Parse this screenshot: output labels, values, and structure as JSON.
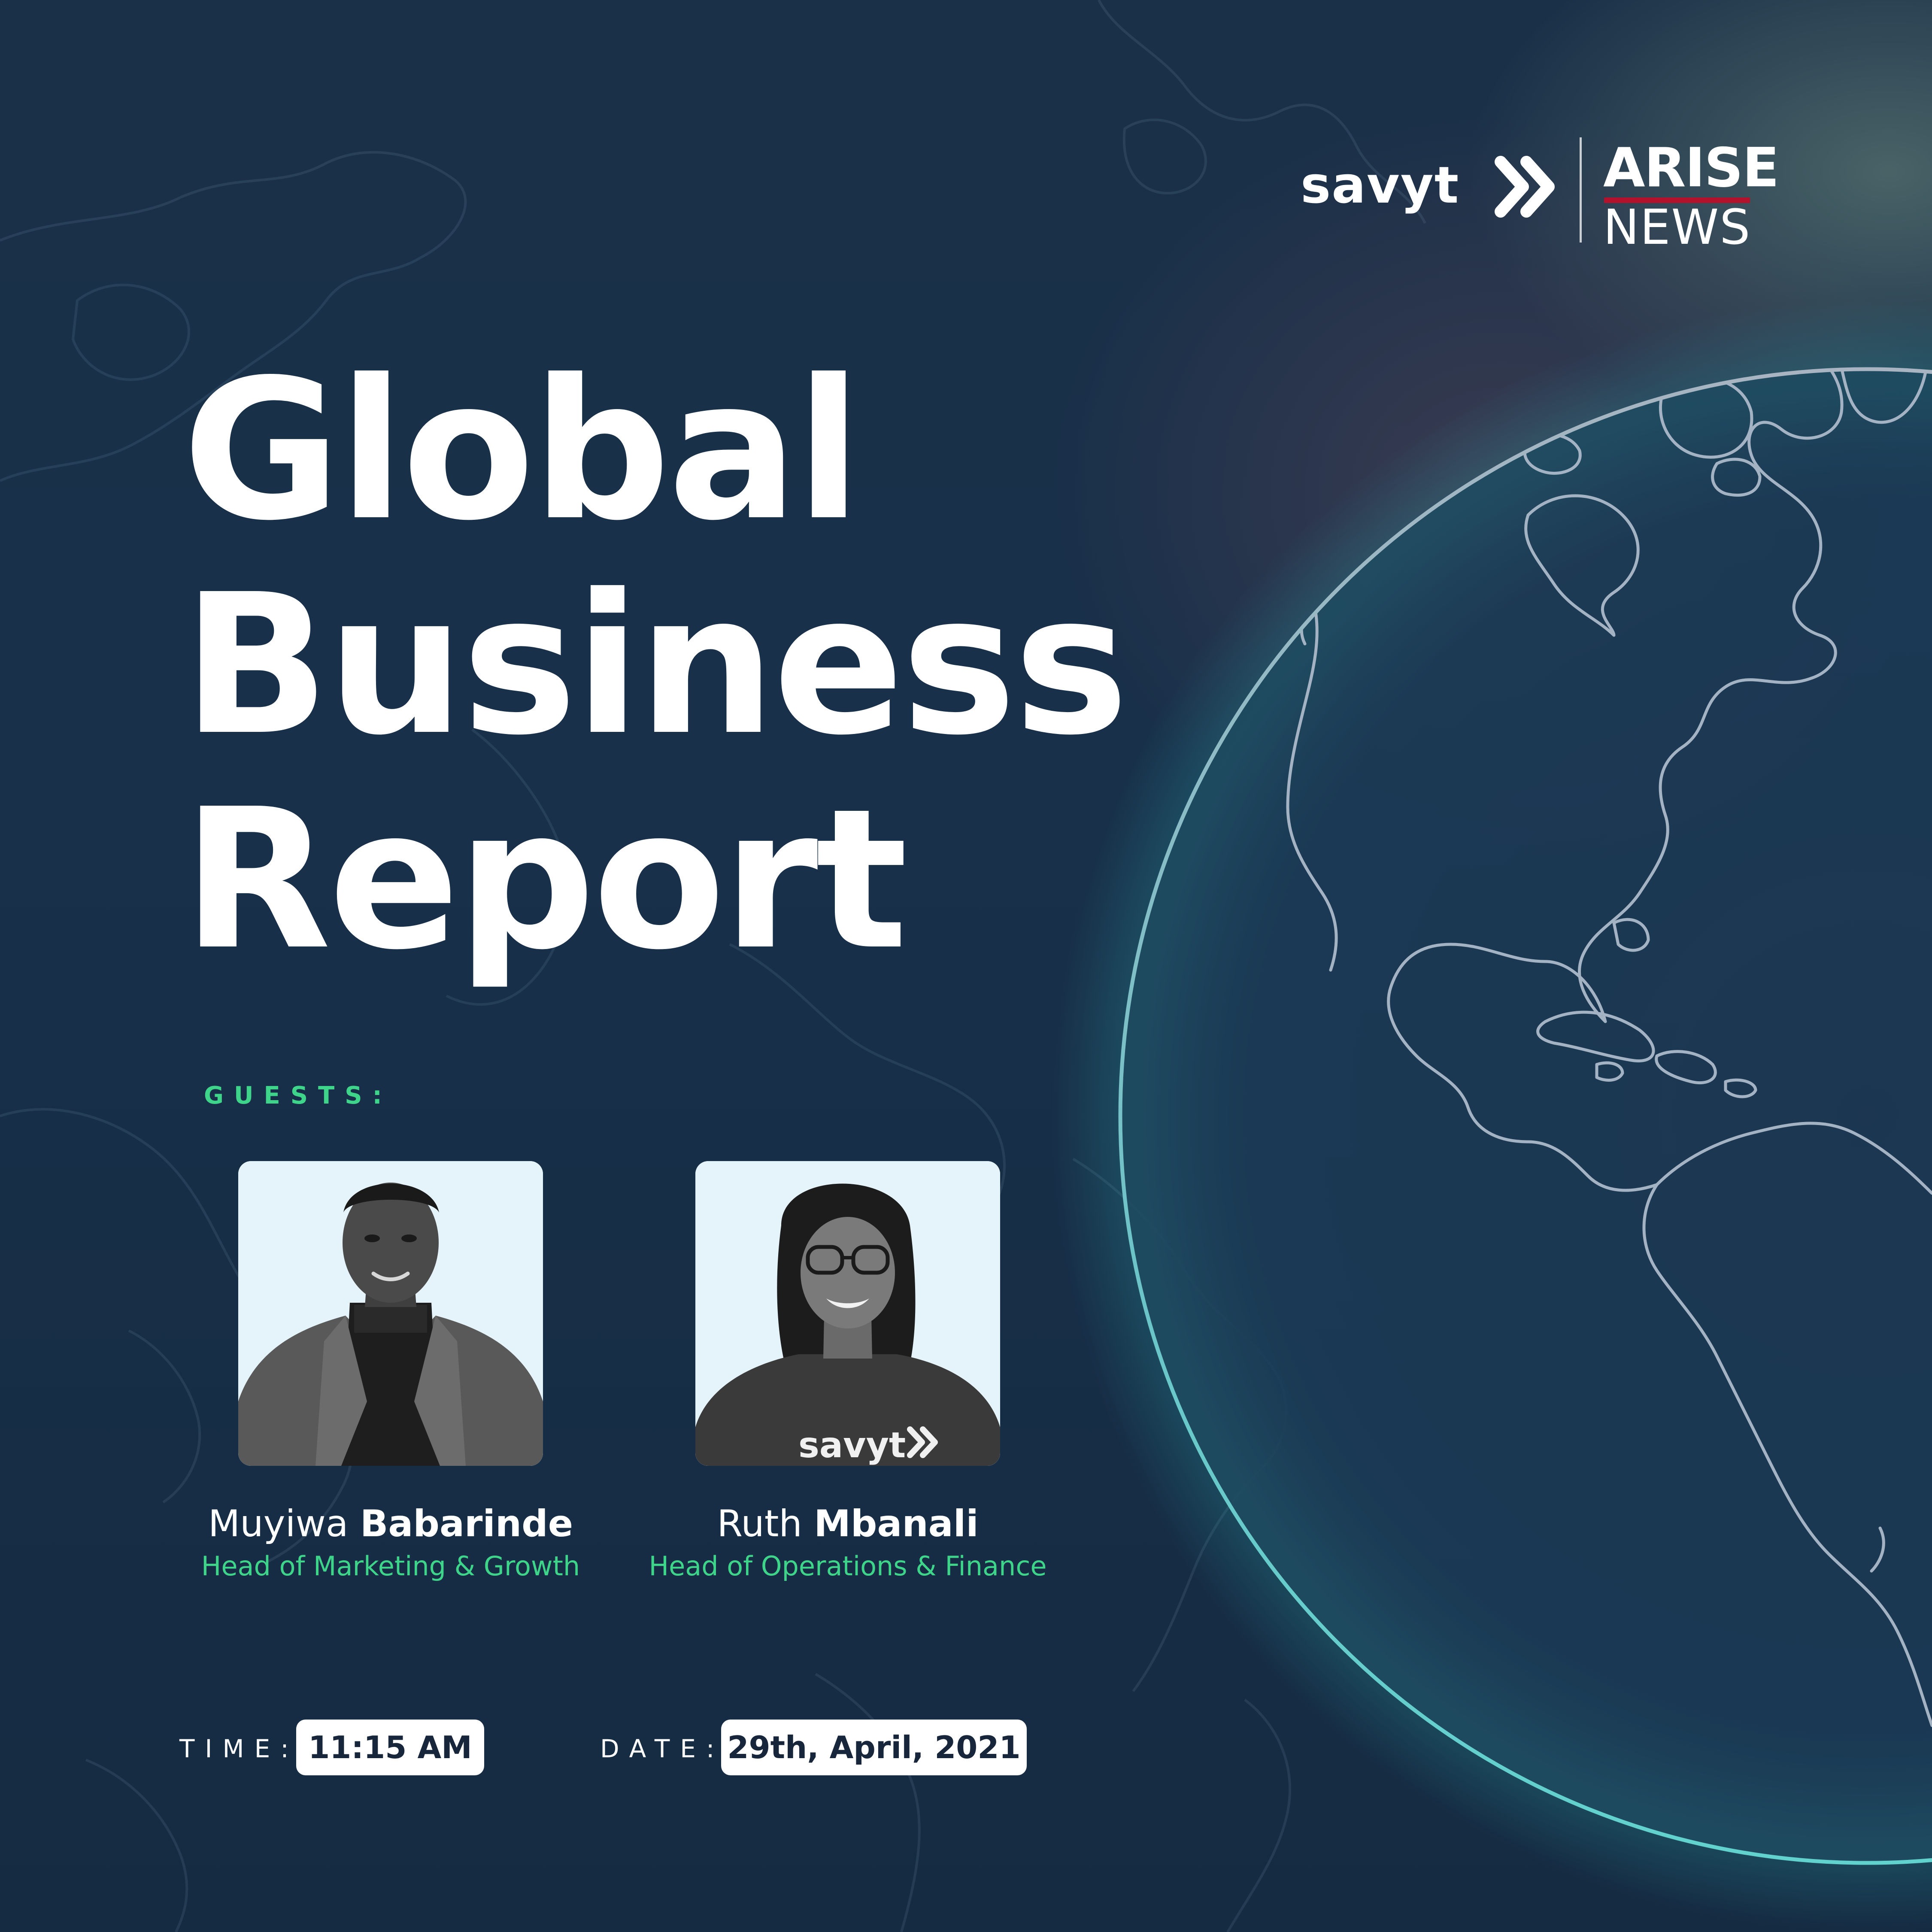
{
  "brand": {
    "savyt_logo": "savyt",
    "partner_logo_top": "ARISE",
    "partner_logo_bottom": "NEWS"
  },
  "title": {
    "line1": "Global",
    "line2": "Business",
    "line3": "Report"
  },
  "guests_label": "GUESTS:",
  "guests": [
    {
      "first_name": "Muyiwa",
      "last_name": "Babarinde",
      "role": "Head of Marketing & Growth"
    },
    {
      "first_name": "Ruth",
      "last_name": "Mbanali",
      "role": "Head of Operations & Finance",
      "shirt_text": "savyt"
    }
  ],
  "time_label": "TIME:",
  "time_value": "11:15 AM",
  "date_label": "DATE:",
  "date_value": "29th, April, 2021",
  "colors": {
    "background": "#162c44",
    "accent_green": "#3ed58b",
    "photo_background": "#e5f4fb",
    "arise_red": "#b3122c",
    "globe_edge": "#7fc9cf"
  }
}
